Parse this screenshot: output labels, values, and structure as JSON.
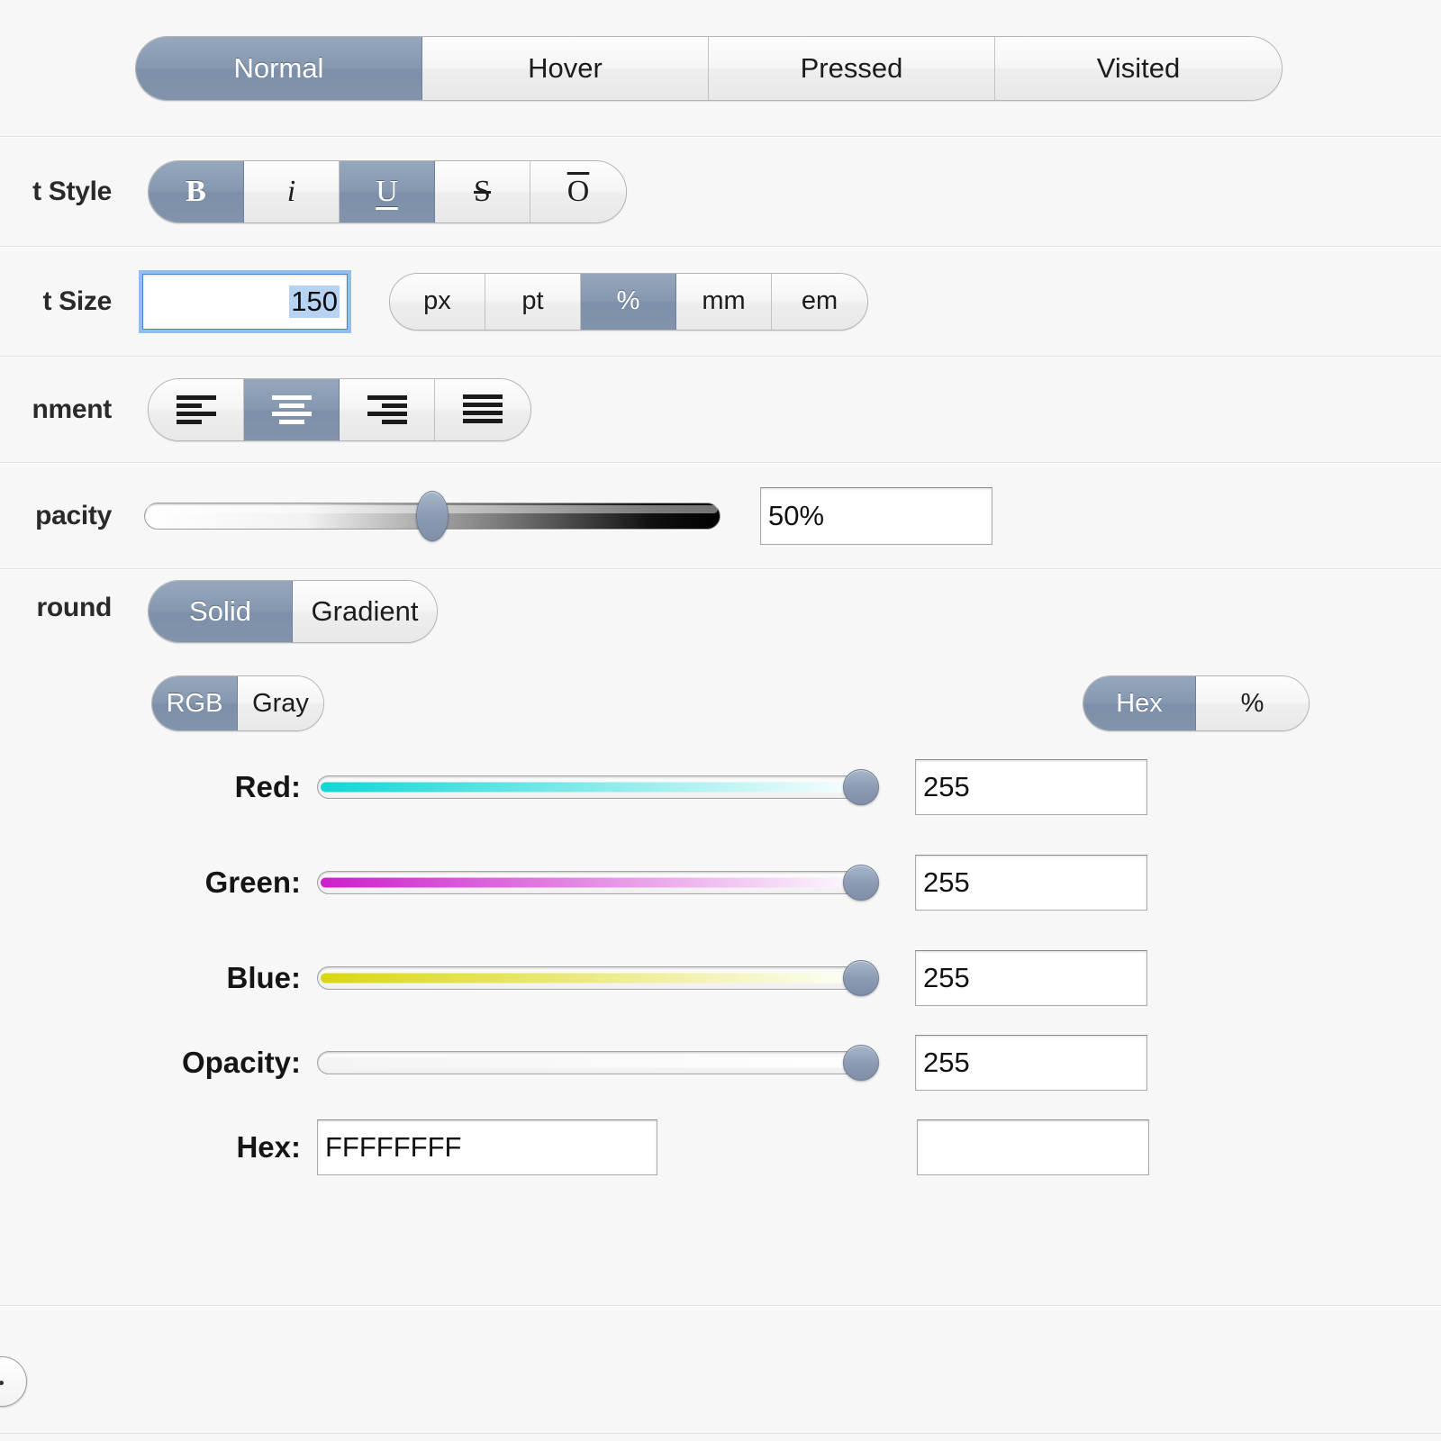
{
  "panel": {
    "background_color": "#f7f7f7",
    "accent_selected": "#8294ac",
    "selection_highlight": "#b6d3f4"
  },
  "state_selector": {
    "name": "element-state",
    "options": [
      "Normal",
      "Hover",
      "Pressed",
      "Visited"
    ],
    "selected": "Normal"
  },
  "rows": {
    "font_style": {
      "label": "t Style",
      "full_label": "Font Style",
      "options": [
        {
          "glyph": "B",
          "name": "bold",
          "on": true
        },
        {
          "glyph": "i",
          "name": "italic",
          "on": false
        },
        {
          "glyph": "U",
          "name": "underline",
          "on": true
        },
        {
          "glyph": "S",
          "name": "strikethrough",
          "on": false
        },
        {
          "glyph": "O",
          "name": "overline",
          "on": false
        }
      ]
    },
    "font_size": {
      "label": "t Size",
      "full_label": "Font Size",
      "value": "150",
      "selected_text": true,
      "units": [
        "px",
        "pt",
        "%",
        "mm",
        "em"
      ],
      "unit_selected": "%"
    },
    "alignment": {
      "label": "nment",
      "full_label": "Alignment",
      "options": [
        "left",
        "center",
        "right",
        "justify"
      ],
      "selected": "center"
    },
    "opacity": {
      "label": "pacity",
      "full_label": "Opacity",
      "slider_percent": 50,
      "value": "50%"
    },
    "background": {
      "label": "round",
      "full_label": "Background",
      "options": [
        "Solid",
        "Gradient"
      ],
      "selected": "Solid"
    }
  },
  "color": {
    "model": {
      "options": [
        "RGB",
        "Gray"
      ],
      "selected": "RGB"
    },
    "notation": {
      "options": [
        "Hex",
        "%"
      ],
      "selected": "Hex"
    },
    "channels": [
      {
        "label": "Red:",
        "value": "255",
        "percent": 100,
        "gradient_from": "#12d6d6",
        "gradient_to": "#ffffff"
      },
      {
        "label": "Green:",
        "value": "255",
        "percent": 100,
        "gradient_from": "#cc1fcc",
        "gradient_to": "#ffffff"
      },
      {
        "label": "Blue:",
        "value": "255",
        "percent": 100,
        "gradient_from": "#d8d80f",
        "gradient_to": "#ffffff"
      },
      {
        "label": "Opacity:",
        "value": "255",
        "percent": 100,
        "gradient_from": "#f4f4f4",
        "gradient_to": "#ffffff"
      }
    ],
    "hex": {
      "label": "Hex:",
      "value": "FFFFFFFF",
      "secondary_value": ""
    }
  }
}
